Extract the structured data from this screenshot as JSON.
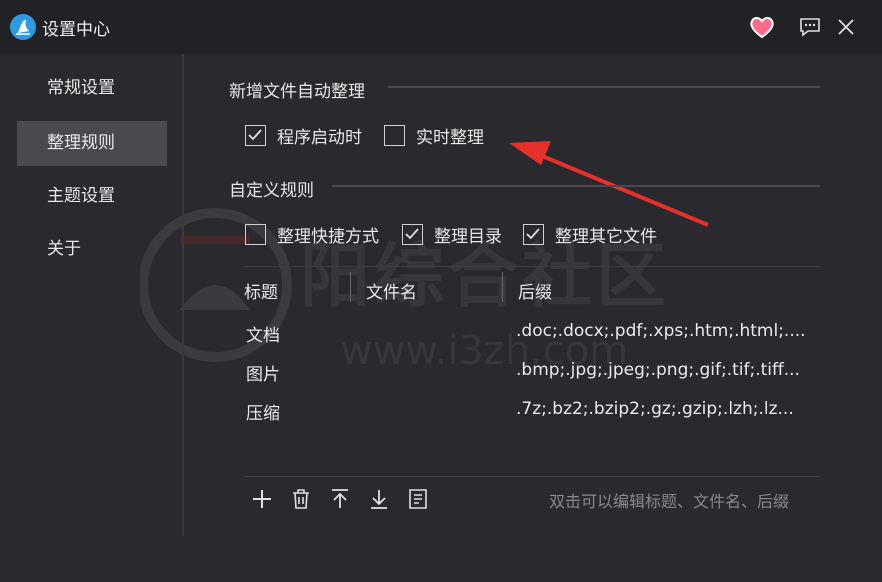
{
  "window": {
    "title": "设置中心"
  },
  "sidebar": {
    "items": [
      {
        "label": "常规设置"
      },
      {
        "label": "整理规则"
      },
      {
        "label": "主题设置"
      },
      {
        "label": "关于"
      }
    ]
  },
  "section_auto": {
    "title": "新增文件自动整理",
    "options": [
      {
        "label": "程序启动时",
        "checked": true
      },
      {
        "label": "实时整理",
        "checked": false
      }
    ]
  },
  "section_custom": {
    "title": "自定义规则",
    "options": [
      {
        "label": "整理快捷方式",
        "checked": false
      },
      {
        "label": "整理目录",
        "checked": true
      },
      {
        "label": "整理其它文件",
        "checked": true
      }
    ]
  },
  "table": {
    "headers": [
      "标题",
      "文件名",
      "后缀"
    ],
    "rows": [
      {
        "title": "文档",
        "filename": "",
        "suffix": ".doc;.docx;.pdf;.xps;.htm;.html;...."
      },
      {
        "title": "图片",
        "filename": "",
        "suffix": ".bmp;.jpg;.jpeg;.png;.gif;.tif;.tiff..."
      },
      {
        "title": "压缩",
        "filename": "",
        "suffix": ".7z;.bz2;.bzip2;.gz;.gzip;.lzh;.lz..."
      }
    ]
  },
  "toolbar": {
    "hint": "双击可以编辑标题、文件名、后缀"
  },
  "watermark": {
    "text": "阳综合社区",
    "url": "www.i3zh.com"
  },
  "colors": {
    "accent_heart": "#ff6b8a",
    "arrow": "#e8302a",
    "logo": "#2c9be0"
  }
}
